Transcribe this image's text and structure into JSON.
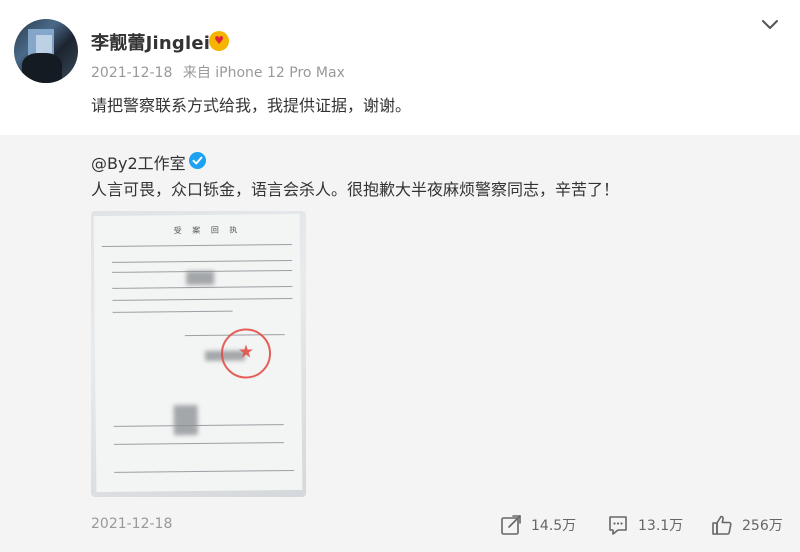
{
  "post": {
    "author": "李靓蕾Jinglei",
    "badge_icon": "mood-emoji-icon",
    "date": "2021-12-18",
    "source": "来自 iPhone 12 Pro Max",
    "text": "请把警察联系方式给我，我提供证据，谢谢。"
  },
  "repost": {
    "author": "@By2工作室",
    "verified_icon": "verified-check-icon",
    "text": "人言可畏，众口铄金，语言会杀人。很抱歉大半夜麻烦警察同志，辛苦了！",
    "image": {
      "title": "受 案 回 执"
    }
  },
  "footer": {
    "date": "2021-12-18",
    "repost_count": "14.5万",
    "comment_count": "13.1万",
    "like_count": "256万"
  },
  "colors": {
    "text_primary": "#333333",
    "text_muted": "#999999",
    "repost_bg": "#f4f4f4",
    "verified_blue": "#1da1f2",
    "badge_yellow": "#f5b400",
    "stamp_red": "#e2463f"
  }
}
